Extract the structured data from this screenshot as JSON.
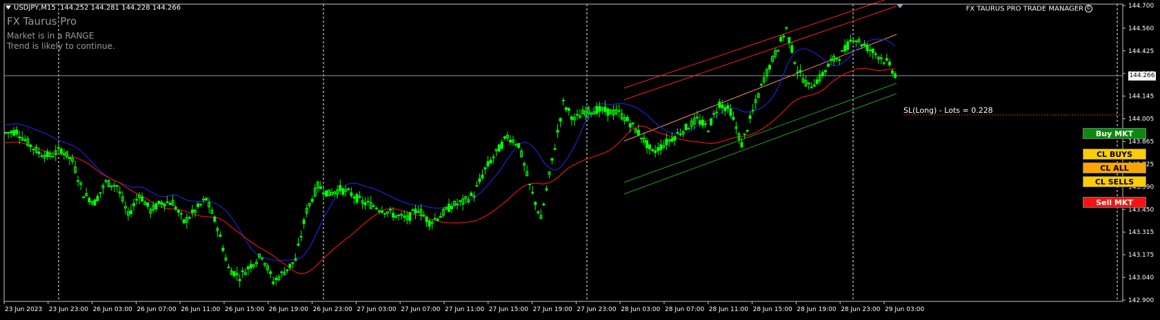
{
  "header": {
    "symbol": "USDJPY,M15",
    "ohlc": "144.252 144.281 144.228 144.266"
  },
  "indicator": {
    "title": "FX Taurus Pro",
    "line1": "Market is in a RANGE",
    "line2": "Trend is likely to continue."
  },
  "trade_manager": {
    "title": "FX TAURUS PRO TRADE MANAGER",
    "copyright_symbol": "©"
  },
  "buttons": {
    "buy_mkt": "Buy MKT",
    "cl_buys": "CL BUYS",
    "cl_all": "CL ALL",
    "cl_sells": "CL SELLS",
    "sell_mkt": "Sell MKT"
  },
  "sl_label": "SL(Long) - Lots = 0.228",
  "current_price": "144.266",
  "colors": {
    "background": "#000000",
    "candle": "#00ff00",
    "ma_blue": "#2020dd",
    "ma_red": "#ee1111",
    "channel_red": "#ff2020",
    "channel_green": "#1fa01f",
    "buy": "#0a8a0a",
    "close": "#ffcc00",
    "close_all": "#ffa500",
    "sell": "#ff1010"
  },
  "price_axis": [
    "144.700",
    "144.560",
    "144.425",
    "144.285",
    "144.145",
    "144.005",
    "143.865",
    "143.725",
    "143.590",
    "143.450",
    "143.315",
    "143.175",
    "143.040",
    "142.900"
  ],
  "time_axis": [
    "23 Jun 2023",
    "23 Jun 23:00",
    "26 Jun 03:00",
    "26 Jun 07:00",
    "26 Jun 11:00",
    "26 Jun 15:00",
    "26 Jun 19:00",
    "26 Jun 23:00",
    "27 Jun 03:00",
    "27 Jun 07:00",
    "27 Jun 11:00",
    "27 Jun 15:00",
    "27 Jun 19:00",
    "27 Jun 23:00",
    "28 Jun 03:00",
    "28 Jun 07:00",
    "28 Jun 11:00",
    "28 Jun 15:00",
    "28 Jun 19:00",
    "28 Jun 23:00",
    "29 Jun 03:00"
  ],
  "chart_data": {
    "type": "candlestick",
    "price_range": [
      142.9,
      144.7
    ],
    "close_series": [
      143.92,
      143.93,
      143.86,
      143.8,
      143.78,
      143.82,
      143.75,
      143.55,
      143.5,
      143.62,
      143.6,
      143.42,
      143.55,
      143.45,
      143.5,
      143.5,
      143.38,
      143.45,
      143.52,
      143.35,
      143.1,
      143.05,
      143.12,
      143.18,
      143.02,
      143.08,
      143.15,
      143.45,
      143.6,
      143.55,
      143.58,
      143.55,
      143.5,
      143.48,
      143.45,
      143.42,
      143.4,
      143.46,
      143.38,
      143.42,
      143.48,
      143.5,
      143.55,
      143.7,
      143.8,
      143.9,
      143.85,
      143.6,
      143.4,
      143.75,
      144.1,
      144.0,
      144.05,
      144.06,
      144.05,
      144.04,
      143.98,
      143.9,
      143.8,
      143.85,
      143.9,
      143.95,
      144.0,
      143.95,
      144.1,
      144.05,
      143.85,
      144.05,
      144.25,
      144.4,
      144.55,
      144.3,
      144.2,
      144.25,
      144.35,
      144.4,
      144.5,
      144.45,
      144.4,
      144.35,
      144.25
    ]
  }
}
